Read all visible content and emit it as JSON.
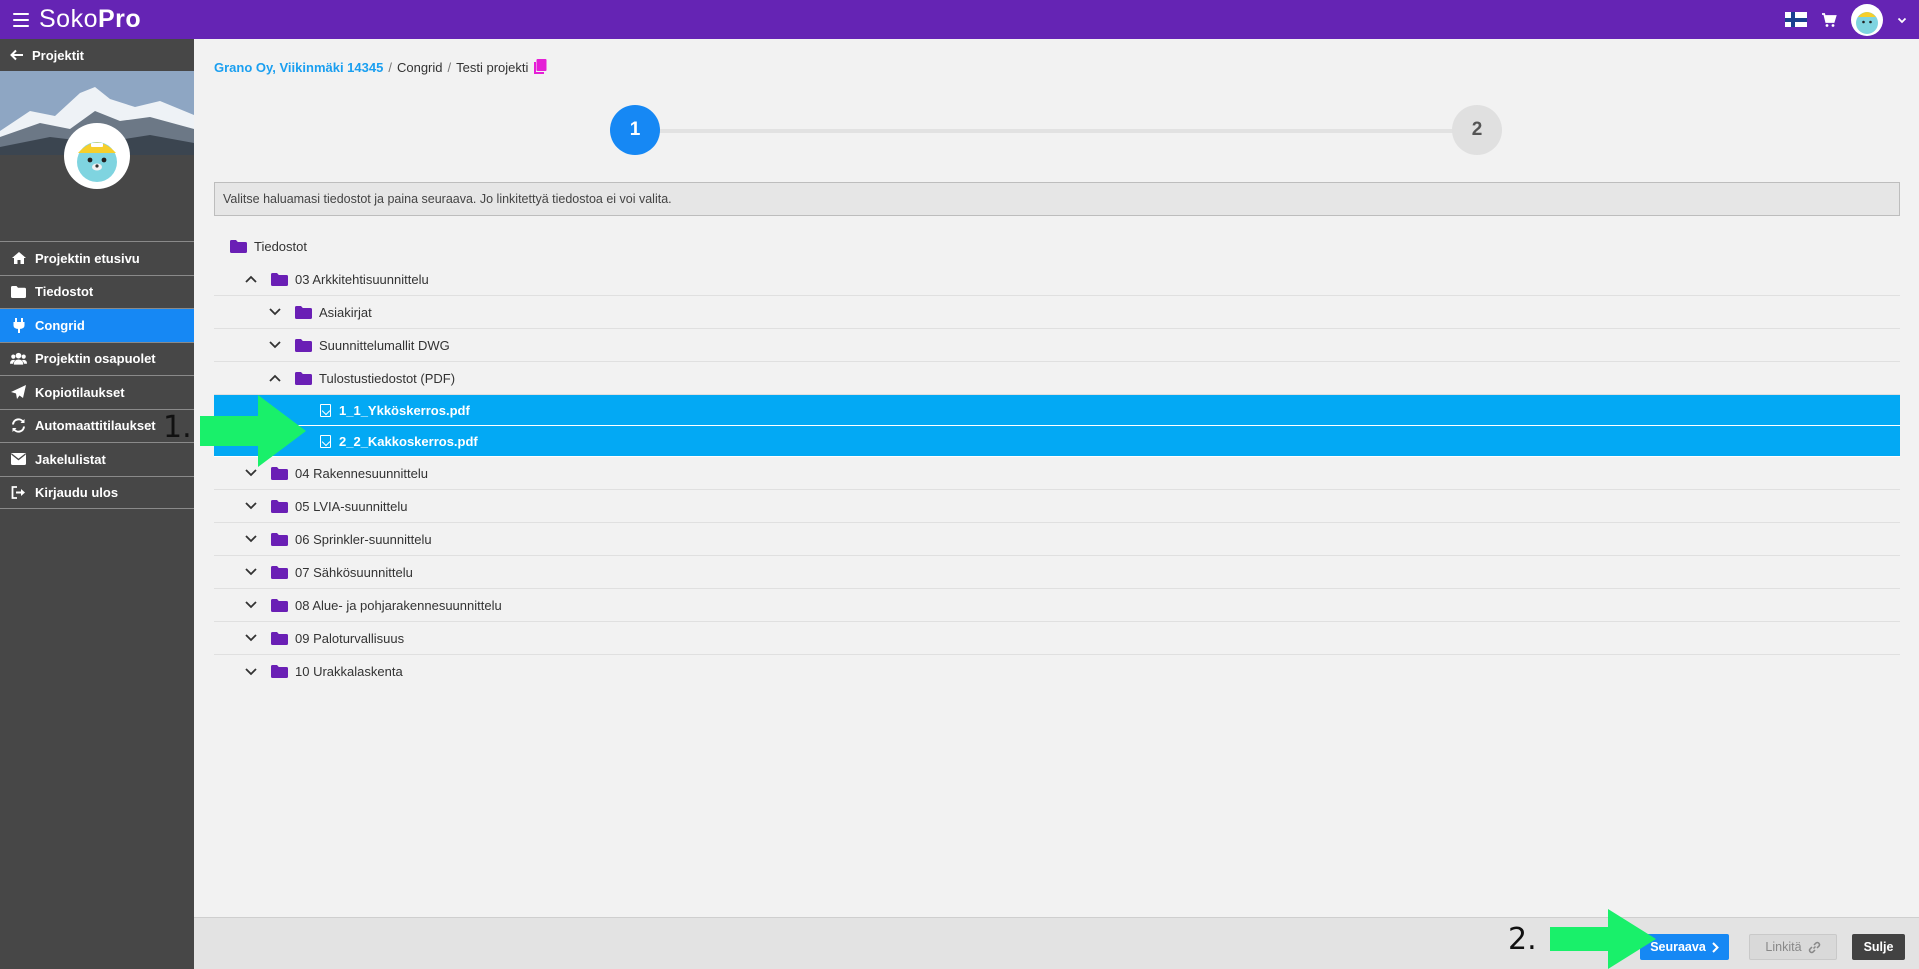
{
  "topbar": {
    "logo_light": "Soko",
    "logo_bold": "Pro",
    "icons": [
      "menu-icon",
      "finland-flag-icon",
      "cart-icon",
      "user-avatar",
      "chevron-down-icon"
    ]
  },
  "sidebar": {
    "back_label": "Projektit",
    "items": [
      {
        "label": "Projektin etusivu",
        "icon": "home-icon"
      },
      {
        "label": "Tiedostot",
        "icon": "folder-icon"
      },
      {
        "label": "Congrid",
        "icon": "plug-icon",
        "active": true
      },
      {
        "label": "Projektin osapuolet",
        "icon": "users-icon"
      },
      {
        "label": "Kopiotilaukset",
        "icon": "paper-plane-icon"
      },
      {
        "label": "Automaattitilaukset",
        "icon": "sync-icon"
      },
      {
        "label": "Jakelulistat",
        "icon": "envelope-icon"
      },
      {
        "label": "Kirjaudu ulos",
        "icon": "sign-out-icon"
      }
    ]
  },
  "breadcrumb": {
    "link": "Grano Oy, Viikinmäki 14345",
    "sep": "/",
    "level2": "Congrid",
    "level3": "Testi projekti"
  },
  "stepper": {
    "step1": "1",
    "step2": "2",
    "active": 1
  },
  "info": "Valitse haluamasi tiedostot ja paina seuraava. Jo linkitettyä tiedostoa ei voi valita.",
  "tree": {
    "root": "Tiedostot",
    "folder_03": "03 Arkkitehtisuunnittelu",
    "sub_asiakirjat": "Asiakirjat",
    "sub_dwg": "Suunnittelumallit DWG",
    "sub_pdf": "Tulostustiedostot (PDF)",
    "file1": "1_1_Ykköskerros.pdf",
    "file2": "2_2_Kakkoskerros.pdf",
    "folder_04": "04 Rakennesuunnittelu",
    "folder_05": "05 LVIA-suunnittelu",
    "folder_06": "06 Sprinkler-suunnittelu",
    "folder_07": "07 Sähkösuunnittelu",
    "folder_08": "08 Alue- ja pohjarakennesuunnittelu",
    "folder_09": "09 Paloturvallisuus",
    "folder_10": "10 Urakkalaskenta"
  },
  "footer": {
    "next_label": "Seuraava",
    "link_label": "Linkitä",
    "close_label": "Sulje"
  },
  "annotations": {
    "label1": "1.",
    "label2": "2."
  },
  "colors": {
    "topbar": "#6524b4",
    "sidebar": "#474747",
    "active_nav": "#1688f4",
    "selected_row": "#03a9f4",
    "folder": "#6a1fb5",
    "arrow": "#19f06a"
  }
}
